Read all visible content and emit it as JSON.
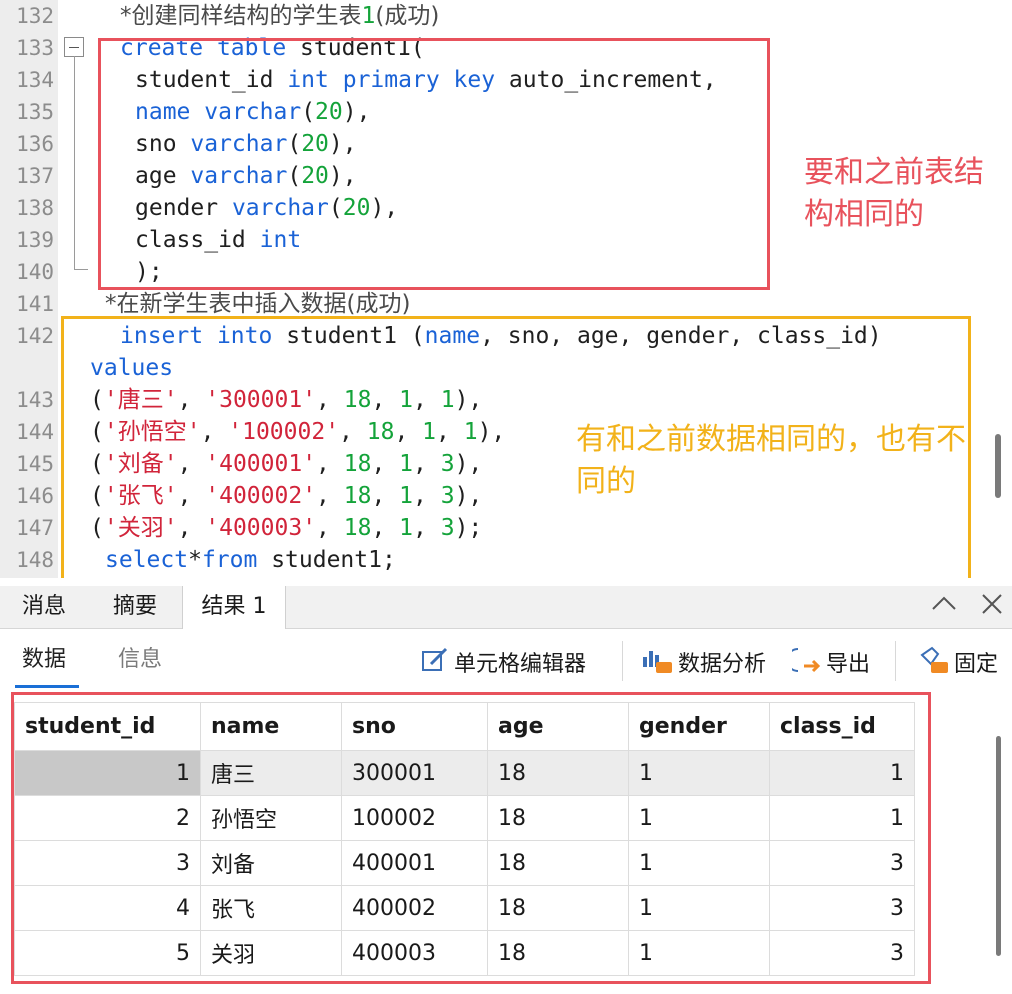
{
  "editor": {
    "lines": [
      {
        "n": "132",
        "indent": 120,
        "parts": [
          {
            "t": "*创建同样结构的学生表",
            "c": "cmt"
          },
          {
            "t": "1",
            "c": "num"
          },
          {
            "t": "(成功)",
            "c": "cmt"
          }
        ]
      },
      {
        "n": "133",
        "indent": 120,
        "parts": [
          {
            "t": "create",
            "c": "kw"
          },
          {
            "t": " "
          },
          {
            "t": "table",
            "c": "kw"
          },
          {
            "t": " student1("
          }
        ]
      },
      {
        "n": "134",
        "indent": 135,
        "parts": [
          {
            "t": "student_id "
          },
          {
            "t": "int",
            "c": "kw"
          },
          {
            "t": " "
          },
          {
            "t": "primary",
            "c": "kw"
          },
          {
            "t": " "
          },
          {
            "t": "key",
            "c": "kw"
          },
          {
            "t": " auto_increment,"
          }
        ]
      },
      {
        "n": "135",
        "indent": 135,
        "parts": [
          {
            "t": "name",
            "c": "kw"
          },
          {
            "t": " "
          },
          {
            "t": "varchar",
            "c": "kw"
          },
          {
            "t": "("
          },
          {
            "t": "20",
            "c": "num"
          },
          {
            "t": "),"
          }
        ]
      },
      {
        "n": "136",
        "indent": 135,
        "parts": [
          {
            "t": "sno "
          },
          {
            "t": "varchar",
            "c": "kw"
          },
          {
            "t": "("
          },
          {
            "t": "20",
            "c": "num"
          },
          {
            "t": "),"
          }
        ]
      },
      {
        "n": "137",
        "indent": 135,
        "parts": [
          {
            "t": "age "
          },
          {
            "t": "varchar",
            "c": "kw"
          },
          {
            "t": "("
          },
          {
            "t": "20",
            "c": "num"
          },
          {
            "t": "),"
          }
        ]
      },
      {
        "n": "138",
        "indent": 135,
        "parts": [
          {
            "t": "gender "
          },
          {
            "t": "varchar",
            "c": "kw"
          },
          {
            "t": "("
          },
          {
            "t": "20",
            "c": "num"
          },
          {
            "t": "),"
          }
        ]
      },
      {
        "n": "139",
        "indent": 135,
        "parts": [
          {
            "t": "class_id "
          },
          {
            "t": "int",
            "c": "kw"
          }
        ]
      },
      {
        "n": "140",
        "indent": 135,
        "parts": [
          {
            "t": ");"
          }
        ]
      },
      {
        "n": "141",
        "indent": 105,
        "parts": [
          {
            "t": "*在新学生表中插入数据(成功)",
            "c": "cmt"
          }
        ]
      },
      {
        "n": "142",
        "indent": 120,
        "parts": [
          {
            "t": "insert",
            "c": "kw"
          },
          {
            "t": " "
          },
          {
            "t": "into",
            "c": "kw"
          },
          {
            "t": " student1 ("
          },
          {
            "t": "name",
            "c": "kw"
          },
          {
            "t": ", sno, age, gender, class_id)"
          }
        ]
      },
      {
        "n": "",
        "indent": 90,
        "parts": [
          {
            "t": "values",
            "c": "kw"
          }
        ]
      },
      {
        "n": "143",
        "indent": 90,
        "parts": [
          {
            "t": "("
          },
          {
            "t": "'唐三'",
            "c": "str"
          },
          {
            "t": ", "
          },
          {
            "t": "'300001'",
            "c": "str"
          },
          {
            "t": ", "
          },
          {
            "t": "18",
            "c": "num"
          },
          {
            "t": ", "
          },
          {
            "t": "1",
            "c": "num"
          },
          {
            "t": ", "
          },
          {
            "t": "1",
            "c": "num"
          },
          {
            "t": "),"
          }
        ]
      },
      {
        "n": "144",
        "indent": 90,
        "parts": [
          {
            "t": "("
          },
          {
            "t": "'孙悟空'",
            "c": "str"
          },
          {
            "t": ", "
          },
          {
            "t": "'100002'",
            "c": "str"
          },
          {
            "t": ", "
          },
          {
            "t": "18",
            "c": "num"
          },
          {
            "t": ", "
          },
          {
            "t": "1",
            "c": "num"
          },
          {
            "t": ", "
          },
          {
            "t": "1",
            "c": "num"
          },
          {
            "t": "),"
          }
        ]
      },
      {
        "n": "145",
        "indent": 90,
        "parts": [
          {
            "t": "("
          },
          {
            "t": "'刘备'",
            "c": "str"
          },
          {
            "t": ", "
          },
          {
            "t": "'400001'",
            "c": "str"
          },
          {
            "t": ", "
          },
          {
            "t": "18",
            "c": "num"
          },
          {
            "t": ", "
          },
          {
            "t": "1",
            "c": "num"
          },
          {
            "t": ", "
          },
          {
            "t": "3",
            "c": "num"
          },
          {
            "t": "),"
          }
        ]
      },
      {
        "n": "146",
        "indent": 90,
        "parts": [
          {
            "t": "("
          },
          {
            "t": "'张飞'",
            "c": "str"
          },
          {
            "t": ", "
          },
          {
            "t": "'400002'",
            "c": "str"
          },
          {
            "t": ", "
          },
          {
            "t": "18",
            "c": "num"
          },
          {
            "t": ", "
          },
          {
            "t": "1",
            "c": "num"
          },
          {
            "t": ", "
          },
          {
            "t": "3",
            "c": "num"
          },
          {
            "t": "),"
          }
        ]
      },
      {
        "n": "147",
        "indent": 90,
        "parts": [
          {
            "t": "("
          },
          {
            "t": "'关羽'",
            "c": "str"
          },
          {
            "t": ", "
          },
          {
            "t": "'400003'",
            "c": "str"
          },
          {
            "t": ", "
          },
          {
            "t": "18",
            "c": "num"
          },
          {
            "t": ", "
          },
          {
            "t": "1",
            "c": "num"
          },
          {
            "t": ", "
          },
          {
            "t": "3",
            "c": "num"
          },
          {
            "t": ");"
          }
        ]
      },
      {
        "n": "148",
        "indent": 105,
        "parts": [
          {
            "t": "select",
            "c": "kw"
          },
          {
            "t": "*"
          },
          {
            "t": "from",
            "c": "kw"
          },
          {
            "t": " student1;"
          }
        ]
      }
    ],
    "annotations": {
      "red_note": "要和之前表结构相同的",
      "yellow_note": "有和之前数据相同的，也有不同的"
    }
  },
  "panel": {
    "tabs": [
      "消息",
      "摘要",
      "结果 1"
    ],
    "active_tab": "结果 1",
    "subtabs": [
      "数据",
      "信息"
    ],
    "toolbar": {
      "cell_editor": "单元格编辑器",
      "data_analysis": "数据分析",
      "export": "导出",
      "pin": "固定"
    },
    "grid": {
      "columns": [
        "student_id",
        "name",
        "sno",
        "age",
        "gender",
        "class_id"
      ],
      "rows": [
        [
          "1",
          "唐三",
          "300001",
          "18",
          "1",
          "1"
        ],
        [
          "2",
          "孙悟空",
          "100002",
          "18",
          "1",
          "1"
        ],
        [
          "3",
          "刘备",
          "400001",
          "18",
          "1",
          "3"
        ],
        [
          "4",
          "张飞",
          "400002",
          "18",
          "1",
          "3"
        ],
        [
          "5",
          "关羽",
          "400003",
          "18",
          "1",
          "3"
        ]
      ]
    }
  },
  "colors": {
    "keyword": "#1a62d6",
    "number": "#14a33a",
    "string": "#d1243a",
    "annotation_red": "#e8525c",
    "annotation_yellow": "#f2b21a"
  }
}
